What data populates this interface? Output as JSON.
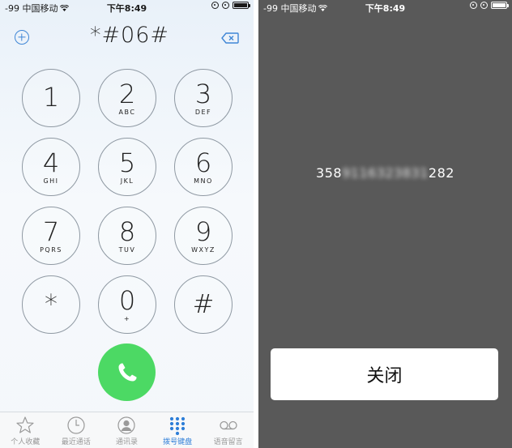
{
  "status_bar": {
    "carrier": "-99 中国移动",
    "time": "下午8:49"
  },
  "dialer": {
    "number": "*#06#",
    "keys": [
      {
        "digit": "1",
        "letters": ""
      },
      {
        "digit": "2",
        "letters": "ABC"
      },
      {
        "digit": "3",
        "letters": "DEF"
      },
      {
        "digit": "4",
        "letters": "GHI"
      },
      {
        "digit": "5",
        "letters": "JKL"
      },
      {
        "digit": "6",
        "letters": "MNO"
      },
      {
        "digit": "7",
        "letters": "PQRS"
      },
      {
        "digit": "8",
        "letters": "TUV"
      },
      {
        "digit": "9",
        "letters": "WXYZ"
      },
      {
        "digit": "*",
        "letters": ""
      },
      {
        "digit": "0",
        "letters": "+"
      },
      {
        "digit": "#",
        "letters": ""
      }
    ],
    "call_color": "#4cd964",
    "accent_color": "#2e7ed8"
  },
  "tabbar": {
    "tabs": [
      {
        "label": "个人收藏",
        "icon": "star-icon",
        "active": false
      },
      {
        "label": "最近通话",
        "icon": "clock-icon",
        "active": false
      },
      {
        "label": "通讯录",
        "icon": "contacts-icon",
        "active": false
      },
      {
        "label": "拨号键盘",
        "icon": "keypad-icon",
        "active": true
      },
      {
        "label": "语音留言",
        "icon": "voicemail-icon",
        "active": false
      }
    ]
  },
  "imei_dialog": {
    "imei_prefix": "358",
    "imei_hidden": "9116323831",
    "imei_suffix": "282",
    "close_label": "关闭"
  }
}
